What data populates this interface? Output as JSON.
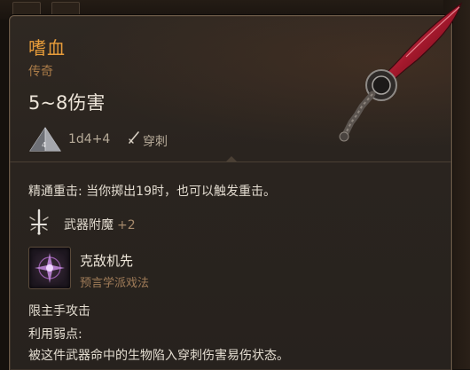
{
  "item": {
    "name": "嗜血",
    "rarity": "传奇",
    "damage": "5~8伤害",
    "dice": "1d4+4",
    "damage_type": "穿刺",
    "icons": {
      "dice": "d4-dice-icon",
      "damage_type": "dagger-pierce-icon",
      "art": "bloodthirst-dagger-art"
    }
  },
  "passives": {
    "crit": "精通重击: 当你掷出19时，也可以触发重击。"
  },
  "enchant": {
    "label": "武器附魔",
    "bonus": "+2",
    "icon": "enchant-sword-icon"
  },
  "spell": {
    "name": "克敌机先",
    "school": "预言学派戏法",
    "icon": "true-strike-spell-icon"
  },
  "restriction": "限主手攻击",
  "exploit": {
    "title": "利用弱点:",
    "description": "被这件武器命中的生物陷入穿刺伤害易伤状态。"
  },
  "colors": {
    "name": "#e79c3a",
    "rarity": "#a87a48",
    "accent_school": "#a07c58",
    "text": "#e3dcd0"
  }
}
